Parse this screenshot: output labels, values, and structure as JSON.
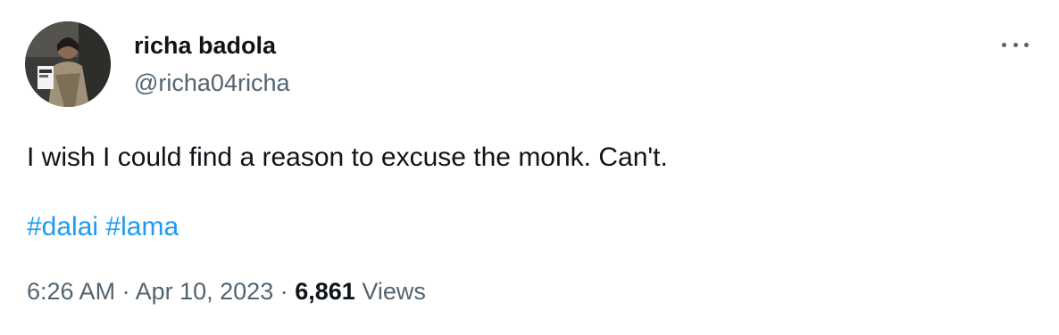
{
  "author": {
    "display_name": "richa badola",
    "handle": "@richa04richa",
    "avatar": "avatar-photo"
  },
  "menu": {
    "icon": "more-horizontal-icon"
  },
  "tweet": {
    "text": "I wish I could find a reason to excuse the monk. Can't.",
    "hashtags": [
      "#dalai",
      "#lama"
    ]
  },
  "meta": {
    "time": "6:26 AM",
    "separator": "·",
    "date": "Apr 10, 2023",
    "views_count": "6,861",
    "views_label": "Views"
  },
  "colors": {
    "text": "#0f1419",
    "secondary": "#536471",
    "link": "#1d9bf0"
  }
}
